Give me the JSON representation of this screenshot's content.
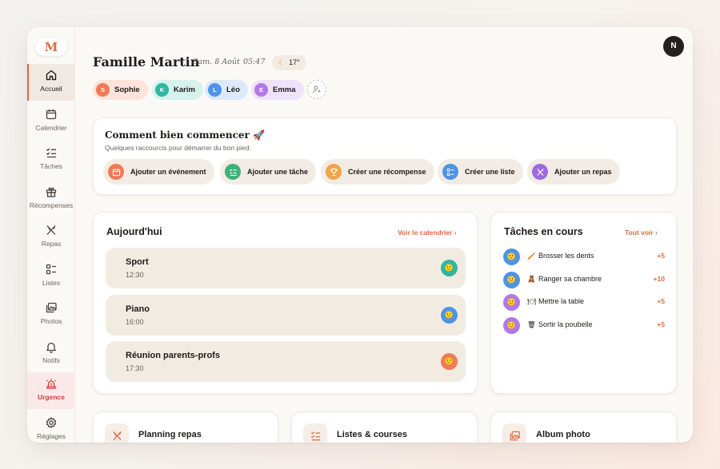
{
  "logo": "M",
  "nav": [
    {
      "label": "Accueil",
      "icon": "home-icon"
    },
    {
      "label": "Calendrier",
      "icon": "calendar-icon"
    },
    {
      "label": "Tâches",
      "icon": "checklist-icon"
    },
    {
      "label": "Récompenses",
      "icon": "gift-icon"
    },
    {
      "label": "Repas",
      "icon": "utensils-icon"
    },
    {
      "label": "Listes",
      "icon": "list-icon"
    },
    {
      "label": "Photos",
      "icon": "photos-icon"
    },
    {
      "label": "Notifs",
      "icon": "bell-icon"
    },
    {
      "label": "Urgence",
      "icon": "siren-icon"
    },
    {
      "label": "Réglages",
      "icon": "gear-icon"
    }
  ],
  "header": {
    "title": "Famille Martin",
    "date": "Sam. 8 Août",
    "time": "05:47",
    "weather": {
      "icon": "moon-icon",
      "temp": "17°"
    },
    "user_initial": "N"
  },
  "members": [
    {
      "initial": "S",
      "name": "Sophie",
      "color": "#f07a55",
      "bg": "#fde3da"
    },
    {
      "initial": "K",
      "name": "Karim",
      "color": "#2fb7a1",
      "bg": "#d7f1ec"
    },
    {
      "initial": "L",
      "name": "Léo",
      "color": "#4d93e8",
      "bg": "#dde9fb"
    },
    {
      "initial": "E",
      "name": "Emma",
      "color": "#b378e6",
      "bg": "#efe2fb"
    }
  ],
  "getting_started": {
    "title": "Comment bien commencer 🚀",
    "subtitle": "Quelques raccourcis pour démarrer du bon pied.",
    "actions": [
      {
        "label": "Ajouter un événement",
        "icon": "calendar-icon",
        "color": "#f07a55"
      },
      {
        "label": "Ajouter une tâche",
        "icon": "checklist-icon",
        "color": "#3fb07a"
      },
      {
        "label": "Créer une récompense",
        "icon": "trophy-icon",
        "color": "#f2a44a"
      },
      {
        "label": "Créer une liste",
        "icon": "list-icon",
        "color": "#4d93e8"
      },
      {
        "label": "Ajouter un repas",
        "icon": "utensils-icon",
        "color": "#9b6ae0"
      }
    ]
  },
  "today": {
    "title": "Aujourd'hui",
    "link": "Voir le calendrier",
    "events": [
      {
        "name": "Sport",
        "time": "12:30",
        "avatar_color": "#2fb7a1",
        "avatar": "🙂"
      },
      {
        "name": "Piano",
        "time": "16:00",
        "avatar_color": "#4d93e8",
        "avatar": "🙂"
      },
      {
        "name": "Réunion parents-profs",
        "time": "17:30",
        "avatar_color": "#f07a55",
        "avatar": "🙂"
      }
    ]
  },
  "tasks": {
    "title": "Tâches en cours",
    "link": "Tout voir",
    "items": [
      {
        "emoji": "🪥",
        "label": "Brosser les dents",
        "points": "+5",
        "avatar_color": "#4d93e8"
      },
      {
        "emoji": "🧸",
        "label": "Ranger sa chambre",
        "points": "+10",
        "avatar_color": "#4d93e8"
      },
      {
        "emoji": "🍽",
        "label": "Mettre la table",
        "points": "+5",
        "avatar_color": "#b378e6"
      },
      {
        "emoji": "🗑",
        "label": "Sortir la poubelle",
        "points": "+5",
        "avatar_color": "#b378e6"
      }
    ]
  },
  "bottom_cards": [
    {
      "title": "Planning repas",
      "icon": "utensils-icon"
    },
    {
      "title": "Listes & courses",
      "icon": "checklist-icon"
    },
    {
      "title": "Album photo",
      "icon": "photos-icon"
    }
  ]
}
